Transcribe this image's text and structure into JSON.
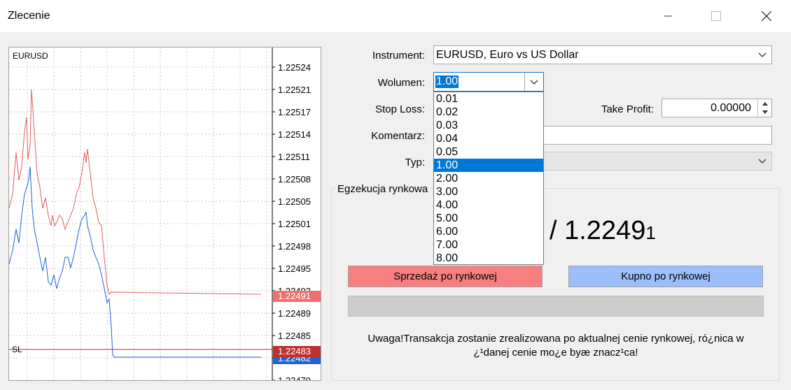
{
  "window": {
    "title": "Zlecenie"
  },
  "chart": {
    "symbol": "EURUSD",
    "sl_label": "SL",
    "price_ticks": [
      "1.22524",
      "1.22521",
      "1.22517",
      "1.22514",
      "1.22511",
      "1.22508",
      "1.22505",
      "1.22501",
      "1.22498",
      "1.22495",
      "1.22492",
      "1.22489",
      "1.22485",
      "1.22482",
      "1.22479"
    ],
    "bid_label": "1.22491",
    "sl_price_label": "1.22483",
    "ask_label": "1.22482",
    "colors": {
      "ask_line": "#e06060",
      "bid_line": "#1e64d2",
      "sl_line": "#b03030",
      "ask_tag": "#f07070",
      "sl_tag": "#c03030",
      "bid_tag": "#1e64d2"
    }
  },
  "form": {
    "instrument_label": "Instrument:",
    "instrument_value": "EURUSD, Euro vs US Dollar",
    "volume_label": "Wolumen:",
    "volume_value": "1.00",
    "volume_options": [
      "0.01",
      "0.02",
      "0.03",
      "0.04",
      "0.05",
      "1.00",
      "2.00",
      "3.00",
      "4.00",
      "5.00",
      "6.00",
      "7.00",
      "8.00"
    ],
    "stop_loss_label": "Stop Loss:",
    "take_profit_label": "Take Profit:",
    "take_profit_value": "0.00000",
    "comment_label": "Komentarz:",
    "type_label": "Typ:"
  },
  "execution": {
    "group_title": "Egzekucja rynkowa",
    "price_main": "/ 1.2249",
    "price_small": "1",
    "sell_button": "Sprzedaż po rynkowej",
    "buy_button": "Kupno po rynkowej",
    "warning_line1": "Uwaga!Transakcja zostanie zrealizowana po aktualnej cenie rynkowej, ró¿nica w",
    "warning_line2": "¿¹danej cenie mo¿e byæ znacz¹ca!"
  }
}
